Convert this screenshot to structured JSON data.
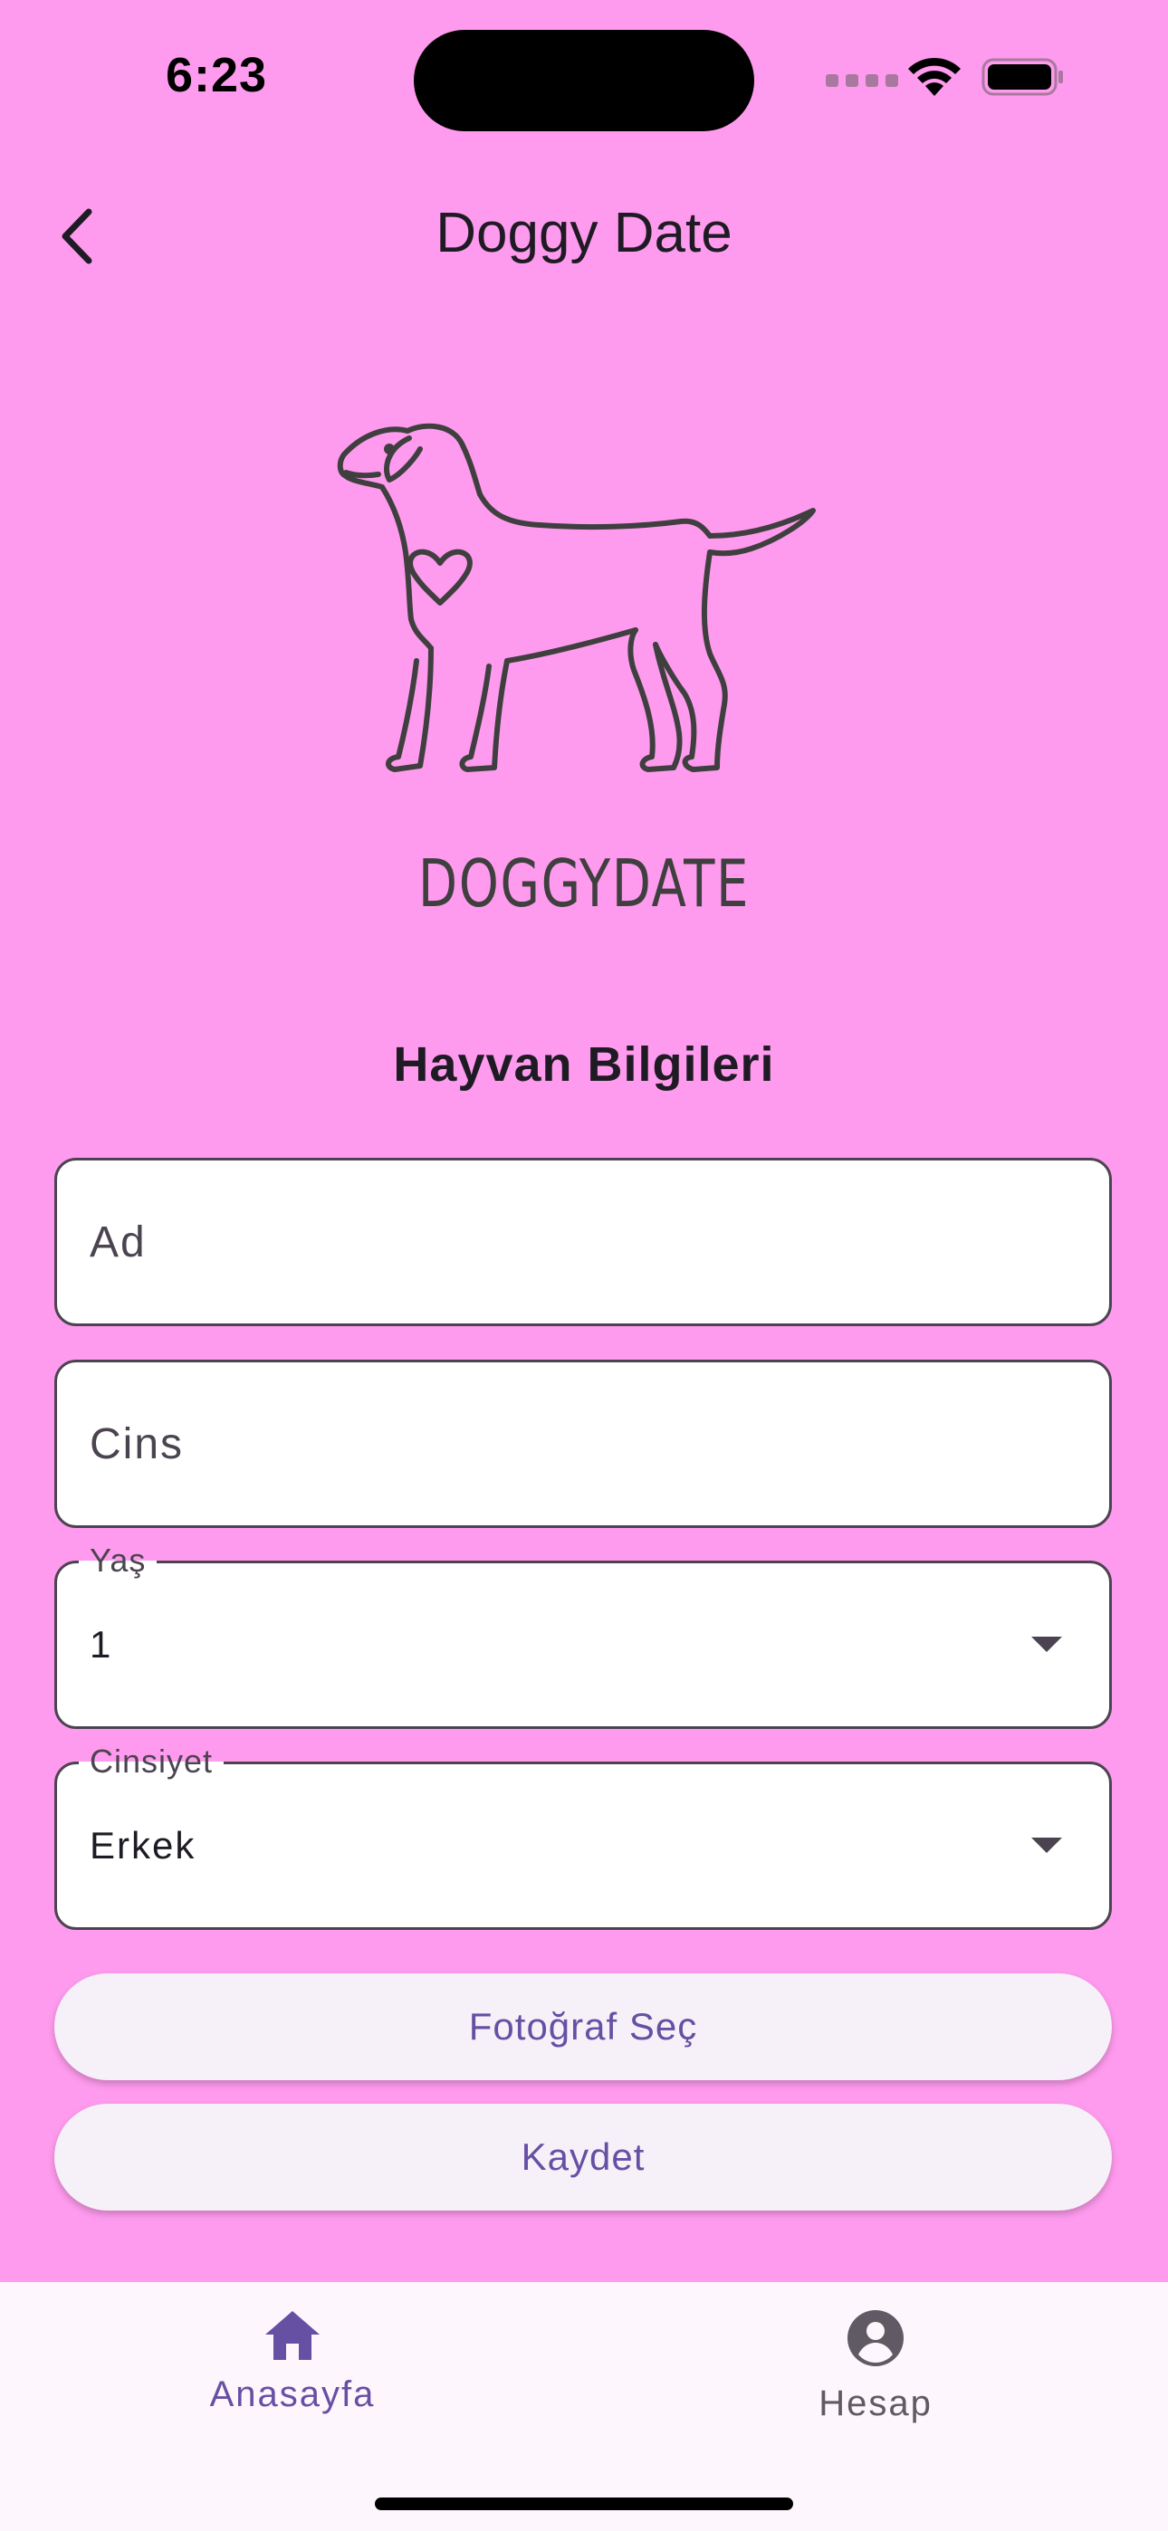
{
  "status_bar": {
    "time": "6:23"
  },
  "app_bar": {
    "title": "Doggy Date",
    "back_icon": "chevron-left-icon"
  },
  "logo": {
    "text": "DOGGYDATE",
    "icon": "dog-with-heart-logo"
  },
  "form": {
    "section_title": "Hayvan Bilgileri",
    "name_field": {
      "placeholder": "Ad",
      "value": ""
    },
    "breed_field": {
      "placeholder": "Cins",
      "value": ""
    },
    "age_select": {
      "label": "Yaş",
      "value": "1"
    },
    "gender_select": {
      "label": "Cinsiyet",
      "value": "Erkek"
    },
    "photo_button": "Fotoğraf Seç",
    "save_button": "Kaydet"
  },
  "bottom_nav": {
    "items": [
      {
        "label": "Anasayfa",
        "icon": "home-icon",
        "active": true
      },
      {
        "label": "Hesap",
        "icon": "account-circle-icon",
        "active": false
      }
    ]
  },
  "colors": {
    "background": "#FF9BEE",
    "accent": "#6650A4",
    "nav_background": "#FDF6FC",
    "field_border": "#4B4450"
  }
}
